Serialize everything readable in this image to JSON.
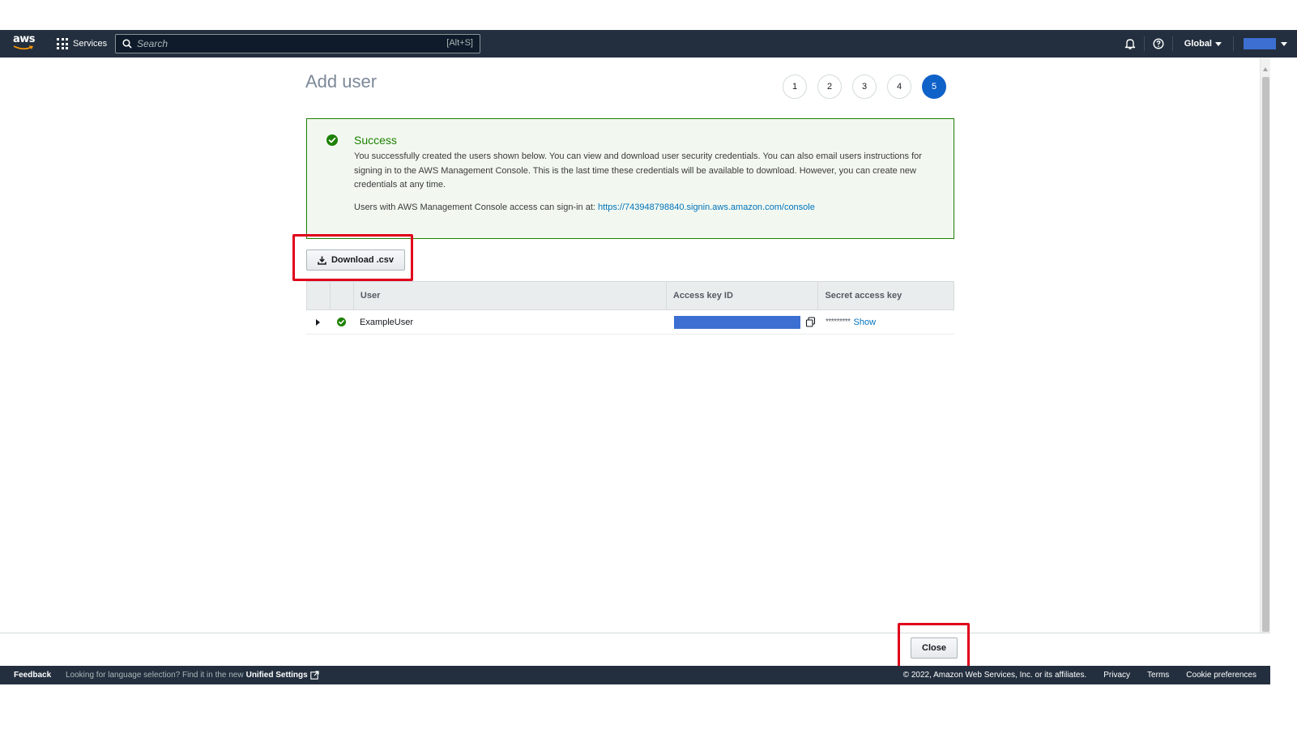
{
  "nav": {
    "logo_text": "aws",
    "services_label": "Services",
    "search_placeholder": "Search",
    "search_shortcut": "[Alt+S]",
    "region_label": "Global"
  },
  "page": {
    "title": "Add user",
    "steps": [
      "1",
      "2",
      "3",
      "4",
      "5"
    ],
    "active_step": "5"
  },
  "alert": {
    "title": "Success",
    "body": "You successfully created the users shown below. You can view and download user security credentials. You can also email users instructions for signing in to the AWS Management Console. This is the last time these credentials will be available to download. However, you can create new credentials at any time.",
    "signin_text": "Users with AWS Management Console access can sign-in at:",
    "signin_url": "https://743948798840.signin.aws.amazon.com/console"
  },
  "download_label": "Download .csv",
  "table": {
    "columns": [
      "User",
      "Access key ID",
      "Secret access key"
    ],
    "rows": [
      {
        "user": "ExampleUser",
        "secret_mask": "*********",
        "show_label": "Show"
      }
    ]
  },
  "close_label": "Close",
  "footer": {
    "feedback": "Feedback",
    "lang_prefix": "Looking for language selection? Find it in the new",
    "lang_link": "Unified Settings",
    "copyright": "© 2022, Amazon Web Services, Inc. or its affiliates.",
    "privacy": "Privacy",
    "terms": "Terms",
    "cookies": "Cookie preferences"
  },
  "colors": {
    "nav_bg": "#232f3e",
    "success_green": "#1d8102",
    "link_blue": "#0073bb",
    "active_step": "#0f62c8",
    "highlight_red": "#e0001b"
  }
}
